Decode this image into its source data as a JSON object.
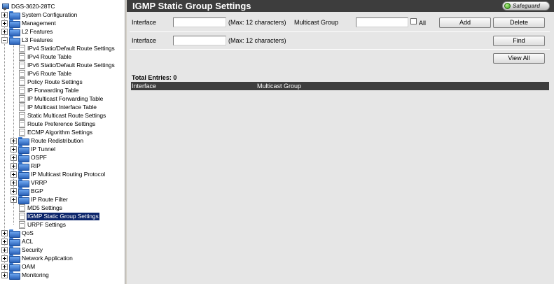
{
  "tree": {
    "root": "DGS-3620-28TC",
    "top_before": [
      {
        "label": "System Configuration"
      },
      {
        "label": "Management"
      },
      {
        "label": "L2 Features"
      }
    ],
    "l3": {
      "label": "L3 Features",
      "leaves_before": [
        "IPv4 Static/Default Route Settings",
        "IPv4 Route Table",
        "IPv6 Static/Default Route Settings",
        "IPv6 Route Table",
        "Policy Route Settings",
        "IP Forwarding Table",
        "IP Multicast Forwarding Table",
        "IP Multicast Interface Table",
        "Static Multicast Route Settings",
        "Route Preference Settings",
        "ECMP Algorithm Settings"
      ],
      "folders": [
        "Route Redistribution",
        "IP Tunnel",
        "OSPF",
        "RIP",
        "IP Multicast Routing Protocol",
        "VRRP",
        "BGP",
        "IP Route Filter"
      ],
      "leaves_after": [
        "MD5 Settings",
        "IGMP Static Group Settings",
        "URPF Settings"
      ],
      "selected": "IGMP Static Group Settings"
    },
    "top_after": [
      {
        "label": "QoS"
      },
      {
        "label": "ACL"
      },
      {
        "label": "Security"
      },
      {
        "label": "Network Application"
      },
      {
        "label": "OAM"
      },
      {
        "label": "Monitoring"
      }
    ]
  },
  "page": {
    "title": "IGMP Static Group Settings",
    "safeguard_label": "Safeguard"
  },
  "form_add": {
    "interface_label": "Interface",
    "interface_value": "",
    "interface_hint": "(Max: 12 characters)",
    "multicast_label": "Multicast Group",
    "multicast_value": "",
    "all_label": "All",
    "all_checked": false,
    "add_button": "Add",
    "delete_button": "Delete"
  },
  "form_find": {
    "interface_label": "Interface",
    "interface_value": "",
    "interface_hint": "(Max: 12 characters)",
    "find_button": "Find"
  },
  "view_all_button": "View All",
  "table": {
    "total_entries": "Total Entries: 0",
    "columns": [
      "Interface",
      "Multicast Group"
    ],
    "rows": []
  },
  "colors": {
    "title_bar": "#3d3d3d",
    "panel_bg": "#e6e6e6",
    "selection": "#0a246a",
    "folder": "#2c63b8"
  }
}
